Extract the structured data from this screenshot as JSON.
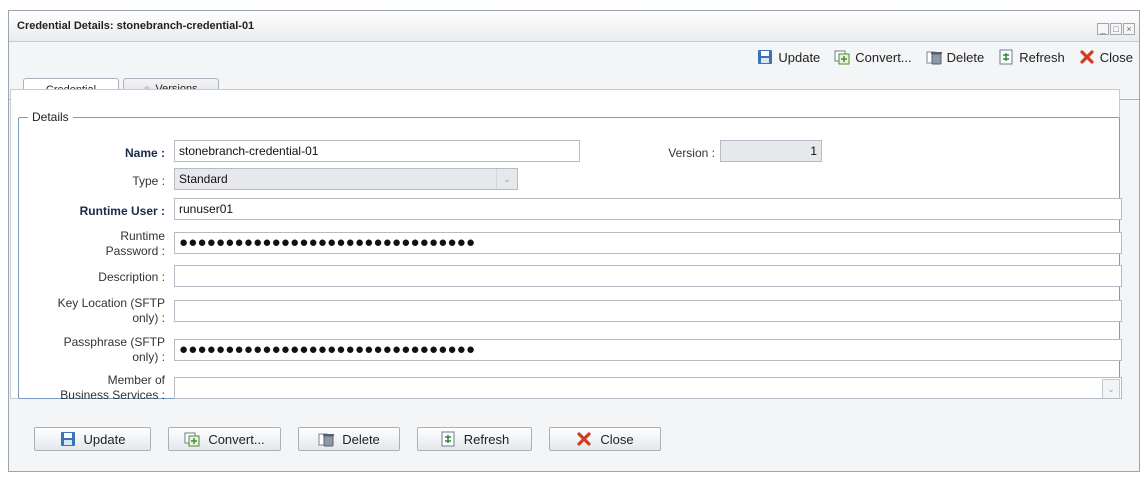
{
  "window": {
    "title": "Credential Details: stonebranch-credential-01",
    "controls": [
      "_",
      "□",
      "×"
    ]
  },
  "toolbar": {
    "update": "Update",
    "convert": "Convert...",
    "delete": "Delete",
    "refresh": "Refresh",
    "close": "Close"
  },
  "tabs": {
    "credential": "Credential",
    "versions": "Versions"
  },
  "details": {
    "legend": "Details",
    "name_label": "Name :",
    "name_value": "stonebranch-credential-01",
    "version_label": "Version :",
    "version_value": "1",
    "type_label": "Type :",
    "type_value": "Standard",
    "runtime_user_label": "Runtime User :",
    "runtime_user_value": "runuser01",
    "runtime_password_label_1": "Runtime",
    "runtime_password_label_2": "Password :",
    "runtime_password_value": "●●●●●●●●●●●●●●●●●●●●●●●●●●●●●●●●",
    "description_label": "Description :",
    "description_value": "",
    "key_location_label_1": "Key Location (SFTP",
    "key_location_label_2": "only) :",
    "key_location_value": "",
    "passphrase_label_1": "Passphrase (SFTP",
    "passphrase_label_2": "only) :",
    "passphrase_value": "●●●●●●●●●●●●●●●●●●●●●●●●●●●●●●●●",
    "business_services_label_1": "Member of",
    "business_services_label_2": "Business Services :",
    "business_services_value": ""
  },
  "bottom_buttons": {
    "update": "Update",
    "convert": "Convert...",
    "delete": "Delete",
    "refresh": "Refresh",
    "close": "Close"
  },
  "icons": {
    "update": "save-disk-icon",
    "convert": "convert-icon",
    "delete": "delete-icon",
    "refresh": "refresh-icon",
    "close": "close-x-icon"
  },
  "colors": {
    "accent_border": "#7b9cc2",
    "label_bold": "#1a2a4a",
    "close_red": "#d23c1e"
  }
}
